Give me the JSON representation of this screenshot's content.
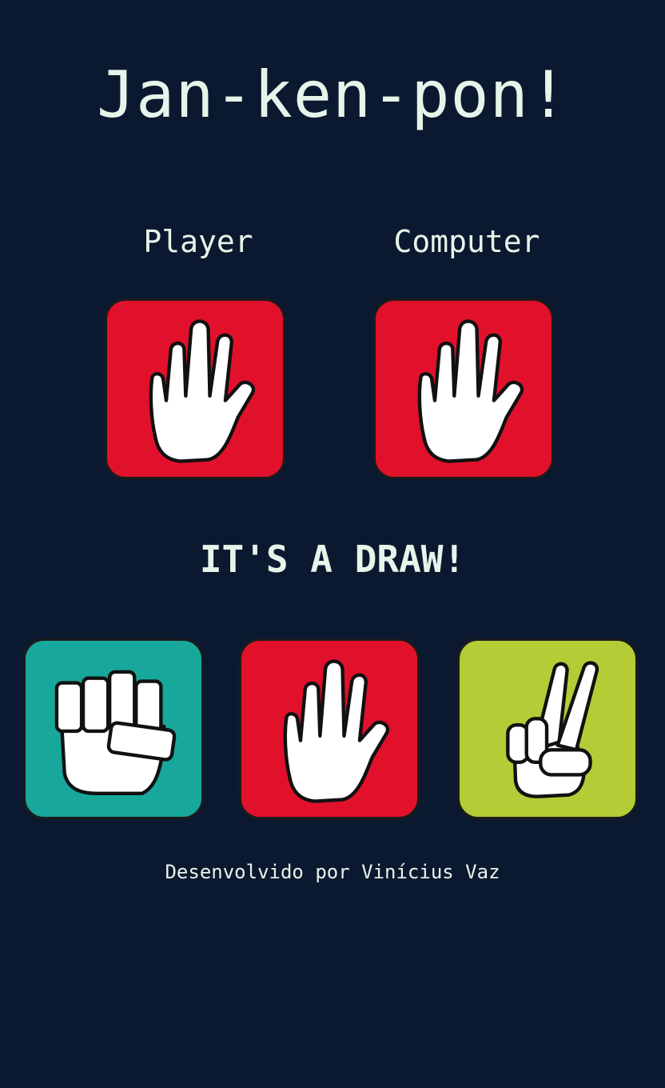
{
  "app": {
    "title": "Jan-ken-pon!"
  },
  "players": {
    "player_label": "Player",
    "computer_label": "Computer"
  },
  "selection": {
    "player_choice": "paper-icon",
    "computer_choice": "paper-icon"
  },
  "result": {
    "text": "IT'S A DRAW!"
  },
  "choices": [
    {
      "name": "rock",
      "icon": "rock-icon",
      "color": "#18a79b"
    },
    {
      "name": "paper",
      "icon": "paper-icon",
      "color": "#e1112c"
    },
    {
      "name": "scissors",
      "icon": "scissors-icon",
      "color": "#b4cc35"
    }
  ],
  "footer": {
    "credit": "Desenvolvido por Vinícius Vaz"
  }
}
